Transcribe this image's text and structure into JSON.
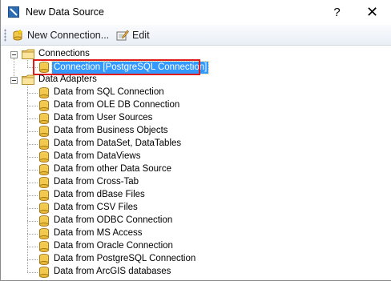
{
  "window": {
    "title": "New Data Source",
    "help_glyph": "?",
    "close_glyph": "✕"
  },
  "toolbar": {
    "new_connection_label": "New Connection...",
    "edit_label": "Edit"
  },
  "tree": {
    "connections": {
      "label": "Connections",
      "items": [
        "Connection [PostgreSQL Connection]"
      ]
    },
    "data_adapters": {
      "label": "Data Adapters",
      "items": [
        "Data from SQL Connection",
        "Data from OLE DB Connection",
        "Data from User Sources",
        "Data from Business Objects",
        "Data from DataSet, DataTables",
        "Data from DataViews",
        "Data from other Data Source",
        "Data from Cross-Tab",
        "Data from dBase Files",
        "Data from CSV Files",
        "Data from ODBC Connection",
        "Data from MS Access",
        "Data from Oracle Connection",
        "Data from PostgreSQL Connection",
        "Data from ArcGIS databases"
      ]
    }
  },
  "colors": {
    "selection": "#3399ff",
    "highlight_border": "#e01b1b"
  }
}
